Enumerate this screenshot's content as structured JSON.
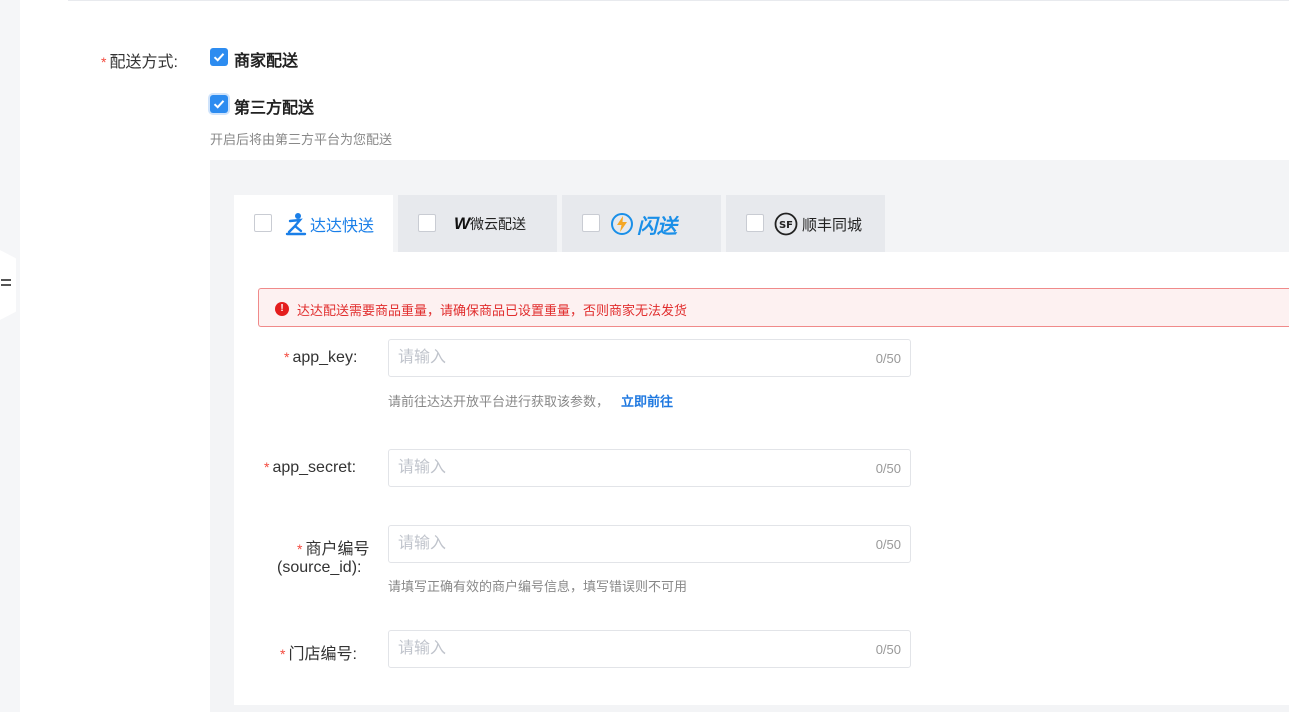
{
  "delivery": {
    "label": "配送方式:",
    "options": [
      {
        "label": "商家配送",
        "checked": true
      },
      {
        "label": "第三方配送",
        "checked": true
      }
    ],
    "third_party_hint": "开启后将由第三方平台为您配送"
  },
  "providers": [
    {
      "name": "达达快送",
      "checked": false,
      "active": true,
      "color": "#1a7fe8"
    },
    {
      "name": "微云配送",
      "checked": false,
      "active": false,
      "color": "#222222"
    },
    {
      "name": "闪送",
      "checked": false,
      "active": false,
      "color": "#1a8fe8"
    },
    {
      "name": "顺丰同城",
      "checked": false,
      "active": false,
      "color": "#222222"
    }
  ],
  "alert": {
    "text": "达达配送需要商品重量，请确保商品已设置重量，否则商家无法发货",
    "color": "#e12e2e"
  },
  "fields": [
    {
      "label": "app_key:",
      "value": "",
      "placeholder": "请输入",
      "counter": "0/50",
      "help": "请前往达达开放平台进行获取该参数，",
      "help_link": "立即前往"
    },
    {
      "label": "app_secret:",
      "value": "",
      "placeholder": "请输入",
      "counter": "0/50"
    },
    {
      "label_line1": "商户编号",
      "label_line2": "(source_id):",
      "value": "",
      "placeholder": "请输入",
      "counter": "0/50",
      "help": "请填写正确有效的商户编号信息，填写错误则不可用"
    },
    {
      "label": "门店编号:",
      "value": "",
      "placeholder": "请输入",
      "counter": "0/50"
    }
  ],
  "required_mark": "*",
  "accent_color": "#2d8cf0"
}
